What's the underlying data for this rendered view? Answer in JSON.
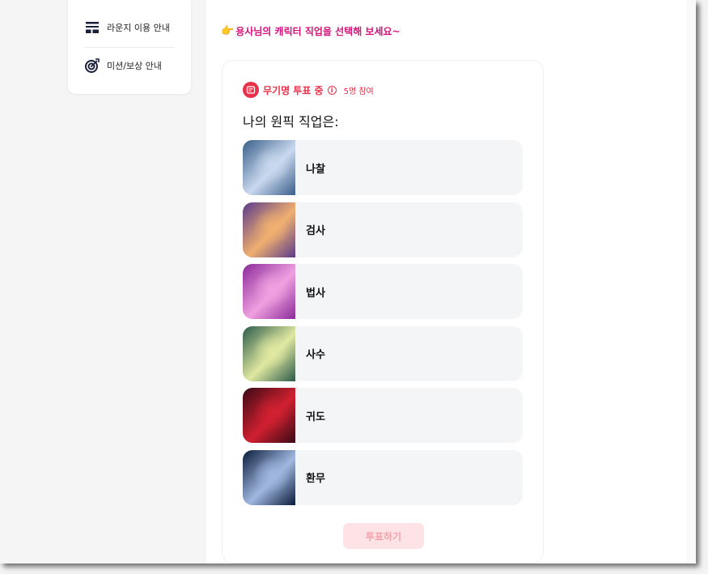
{
  "sidebar": {
    "items": [
      {
        "label": "라운지 이용 안내",
        "icon": "layout-icon"
      },
      {
        "label": "미션/보상 안내",
        "icon": "target-icon"
      }
    ]
  },
  "main": {
    "prompt": "용사님의 캐릭터 직업을 선택해 보세요~",
    "poll": {
      "status": "무기명 투표 중",
      "participants": "5명 참여",
      "question": "나의 원픽 직업은:",
      "options": [
        {
          "label": "나찰",
          "thumb_colors": [
            "#3a5e8a",
            "#c9d9ee"
          ]
        },
        {
          "label": "검사",
          "thumb_colors": [
            "#5a3a8a",
            "#f0b070"
          ]
        },
        {
          "label": "법사",
          "thumb_colors": [
            "#8a2a9a",
            "#f0a0e0"
          ]
        },
        {
          "label": "사수",
          "thumb_colors": [
            "#2a5a4a",
            "#e0e8a0"
          ]
        },
        {
          "label": "귀도",
          "thumb_colors": [
            "#3a0a14",
            "#d02030"
          ]
        },
        {
          "label": "환무",
          "thumb_colors": [
            "#0a1a3a",
            "#a0b8e0"
          ]
        }
      ],
      "submit_label": "투표하기"
    }
  },
  "colors": {
    "accent": "#e8314a",
    "prompt": "#d4147a",
    "submit_bg": "#fde3e5"
  }
}
